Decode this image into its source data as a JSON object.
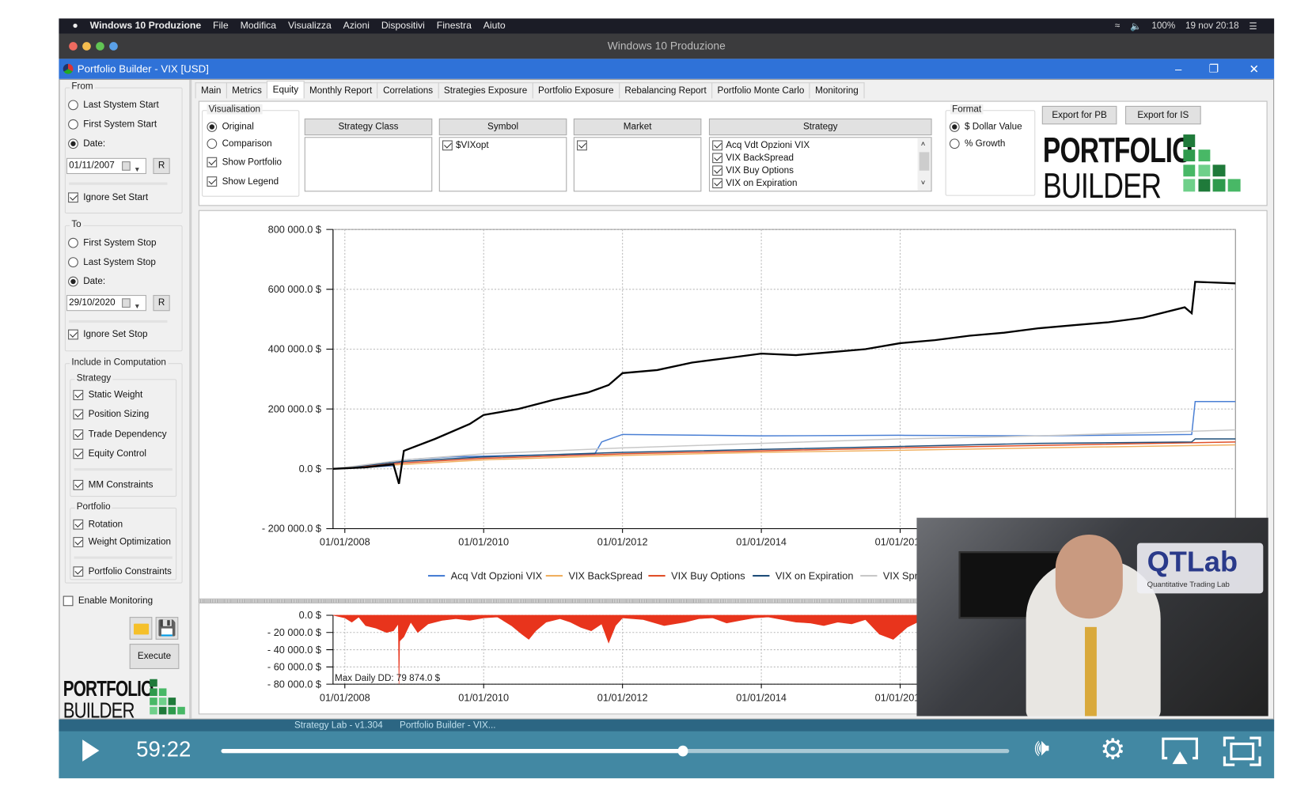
{
  "mac_menubar": {
    "app_name": "Windows 10 Produzione",
    "menus": [
      "File",
      "Modifica",
      "Visualizza",
      "Azioni",
      "Dispositivi",
      "Finestra",
      "Aiuto"
    ],
    "battery": "100%",
    "datetime": "19 nov  20:18"
  },
  "vm_window": {
    "title": "Windows 10 Produzione"
  },
  "app": {
    "title": "Portfolio Builder - VIX [USD]",
    "tabs": [
      {
        "label": "Main",
        "active": false
      },
      {
        "label": "Metrics",
        "active": false
      },
      {
        "label": "Equity",
        "active": true
      },
      {
        "label": "Monthly Report",
        "active": false
      },
      {
        "label": "Correlations",
        "active": false
      },
      {
        "label": "Strategies Exposure",
        "active": false
      },
      {
        "label": "Portfolio Exposure",
        "active": false
      },
      {
        "label": "Rebalancing Report",
        "active": false
      },
      {
        "label": "Portfolio Monte Carlo",
        "active": false
      },
      {
        "label": "Monitoring",
        "active": false
      }
    ]
  },
  "left": {
    "from": {
      "label": "From",
      "options": [
        {
          "label": "Last Stystem Start",
          "checked": false
        },
        {
          "label": "First System Start",
          "checked": false
        },
        {
          "label": "Date:",
          "checked": true
        }
      ],
      "date": "01/11/2007",
      "reset": "R",
      "ignore": {
        "label": "Ignore Set Start",
        "checked": true
      }
    },
    "to": {
      "label": "To",
      "options": [
        {
          "label": "First System Stop",
          "checked": false
        },
        {
          "label": "Last System Stop",
          "checked": false
        },
        {
          "label": "Date:",
          "checked": true
        }
      ],
      "date": "29/10/2020",
      "reset": "R",
      "ignore": {
        "label": "Ignore Set Stop",
        "checked": true
      }
    },
    "include": {
      "label": "Include in Computation",
      "strategy": {
        "label": "Strategy",
        "items": [
          {
            "label": "Static Weight",
            "checked": true
          },
          {
            "label": "Position Sizing",
            "checked": true
          },
          {
            "label": "Trade Dependency",
            "checked": true
          },
          {
            "label": "Equity Control",
            "checked": true
          },
          {
            "label": "MM Constraints",
            "checked": true
          }
        ]
      },
      "portfolio": {
        "label": "Portfolio",
        "items": [
          {
            "label": "Rotation",
            "checked": true
          },
          {
            "label": "Weight Optimization",
            "checked": true
          },
          {
            "label": "Portfolio Constraints",
            "checked": true
          }
        ]
      }
    },
    "enable_monitoring": {
      "label": "Enable Monitoring",
      "checked": false
    },
    "execute": "Execute",
    "logo": {
      "line1": "PORTFOLIO",
      "line2": "BUILDER"
    }
  },
  "visualisation": {
    "label": "Visualisation",
    "modes": [
      {
        "label": "Original",
        "checked": true
      },
      {
        "label": "Comparison",
        "checked": false
      }
    ],
    "show": [
      {
        "label": "Show Portfolio",
        "checked": true
      },
      {
        "label": "Show Legend",
        "checked": true
      }
    ],
    "filters": [
      {
        "header": "Strategy Class",
        "items": []
      },
      {
        "header": "Symbol",
        "items": [
          {
            "label": "$VIXopt",
            "checked": true
          }
        ]
      },
      {
        "header": "Market",
        "items": [
          {
            "label": "",
            "checked": true
          }
        ]
      },
      {
        "header": "Strategy",
        "items": [
          {
            "label": "Acq Vdt Opzioni VIX",
            "checked": true
          },
          {
            "label": "VIX BackSpread",
            "checked": true
          },
          {
            "label": "VIX Buy Options",
            "checked": true
          },
          {
            "label": "VIX on Expiration",
            "checked": true
          }
        ]
      }
    ]
  },
  "format": {
    "label": "Format",
    "options": [
      {
        "label": "$ Dollar Value",
        "checked": true
      },
      {
        "label": "% Growth",
        "checked": false
      }
    ]
  },
  "export": {
    "pb": "Export for PB",
    "is": "Export for IS"
  },
  "brand_logo": {
    "line1": "PORTFOLIO",
    "line2": "BUILDER",
    "color": "#3aa55a"
  },
  "chart_data": [
    {
      "type": "line",
      "y_ticks": [
        "800 000.0 $",
        "600 000.0 $",
        "400 000.0 $",
        "200 000.0 $",
        "0.0 $",
        "- 200 000.0 $"
      ],
      "y_tick_values": [
        800000,
        600000,
        400000,
        200000,
        0,
        -200000
      ],
      "x_ticks": [
        "01/01/2008",
        "01/01/2010",
        "01/01/2012",
        "01/01/2014",
        "01/01/2016"
      ],
      "x_tick_values": [
        2008,
        2010,
        2012,
        2014,
        2016
      ],
      "xlim": [
        "01/11/2007",
        "29/10/2020"
      ],
      "ylim": [
        -200000,
        800000
      ],
      "grid": true,
      "legend_placement": "bottom",
      "series": [
        {
          "name": "Portfolio",
          "color": "#000000",
          "x": [
            2007.83,
            2008.3,
            2008.7,
            2008.78,
            2008.85,
            2009.3,
            2009.8,
            2010.0,
            2010.5,
            2011.0,
            2011.5,
            2011.8,
            2012.0,
            2012.5,
            2013.0,
            2013.5,
            2014.0,
            2014.5,
            2015.0,
            2015.5,
            2016.0,
            2016.5,
            2017.0,
            2017.5,
            2018.0,
            2018.5,
            2019.0,
            2019.5,
            2020.1,
            2020.2,
            2020.25,
            2020.83
          ],
          "y": [
            0,
            5000,
            15000,
            -50000,
            60000,
            100000,
            150000,
            180000,
            200000,
            230000,
            255000,
            280000,
            320000,
            330000,
            355000,
            370000,
            385000,
            380000,
            390000,
            400000,
            420000,
            430000,
            445000,
            455000,
            470000,
            480000,
            490000,
            505000,
            540000,
            520000,
            625000,
            620000
          ]
        },
        {
          "name": "Acq Vdt Opzioni VIX",
          "color": "#4a7fd4",
          "x": [
            2007.83,
            2008.7,
            2008.85,
            2009.5,
            2010.5,
            2011.6,
            2011.7,
            2012.0,
            2014.0,
            2016.0,
            2018.0,
            2020.2,
            2020.25,
            2020.83
          ],
          "y": [
            0,
            10000,
            30000,
            40000,
            45000,
            50000,
            90000,
            115000,
            110000,
            112000,
            110000,
            115000,
            225000,
            225000
          ]
        },
        {
          "name": "VIX BackSpread",
          "color": "#f0b060",
          "x": [
            2007.83,
            2008.85,
            2010.0,
            2012.0,
            2014.0,
            2016.0,
            2018.0,
            2020.83
          ],
          "y": [
            0,
            15000,
            30000,
            45000,
            55000,
            62000,
            70000,
            80000
          ]
        },
        {
          "name": "VIX Buy Options",
          "color": "#e0502a",
          "x": [
            2007.83,
            2008.85,
            2010.0,
            2012.0,
            2014.0,
            2016.0,
            2018.0,
            2020.83
          ],
          "y": [
            0,
            20000,
            35000,
            50000,
            60000,
            70000,
            78000,
            90000
          ]
        },
        {
          "name": "VIX on Expiration",
          "color": "#1f4e79",
          "x": [
            2007.83,
            2008.85,
            2010.0,
            2012.0,
            2014.0,
            2016.0,
            2018.0,
            2020.2,
            2020.25,
            2020.83
          ],
          "y": [
            0,
            25000,
            40000,
            55000,
            65000,
            75000,
            85000,
            90000,
            100000,
            100000
          ]
        },
        {
          "name": "VIX Spread",
          "color": "#c8c8c8",
          "x": [
            2007.83,
            2008.85,
            2010.0,
            2012.0,
            2014.0,
            2016.0,
            2018.0,
            2020.83
          ],
          "y": [
            0,
            30000,
            50000,
            70000,
            85000,
            100000,
            110000,
            130000
          ]
        }
      ]
    },
    {
      "type": "area",
      "y_ticks": [
        "0.0 $",
        "- 20 000.0 $",
        "- 40 000.0 $",
        "- 60 000.0 $",
        "- 80 000.0 $"
      ],
      "y_tick_values": [
        0,
        -20000,
        -40000,
        -60000,
        -80000
      ],
      "x_ticks": [
        "01/01/2008",
        "01/01/2010",
        "01/01/2012",
        "01/01/2014",
        "01/01/2016"
      ],
      "x_tick_values": [
        2008,
        2010,
        2012,
        2014,
        2016
      ],
      "ylim": [
        -80000,
        0
      ],
      "annotation": "Max Daily DD:   79 874.0 $",
      "color": "#e8341c",
      "x": [
        2007.83,
        2008.0,
        2008.1,
        2008.2,
        2008.3,
        2008.45,
        2008.6,
        2008.7,
        2008.77,
        2008.78,
        2008.79,
        2008.85,
        2008.95,
        2009.05,
        2009.2,
        2009.4,
        2009.6,
        2009.8,
        2010.0,
        2010.2,
        2010.4,
        2010.55,
        2010.65,
        2010.75,
        2010.9,
        2011.1,
        2011.25,
        2011.4,
        2011.55,
        2011.7,
        2011.8,
        2011.9,
        2012.0,
        2012.3,
        2012.6,
        2012.9,
        2013.1,
        2013.3,
        2013.5,
        2013.7,
        2013.9,
        2014.1,
        2014.3,
        2014.5,
        2014.7,
        2014.9,
        2015.1,
        2015.3,
        2015.5,
        2015.7,
        2015.9,
        2016.1,
        2016.3,
        2016.5,
        2016.7,
        2016.9,
        2017.2,
        2017.5,
        2017.8,
        2018.0,
        2018.1,
        2018.3,
        2018.6,
        2018.9,
        2019.2,
        2019.5,
        2019.8,
        2020.1,
        2020.2,
        2020.3,
        2020.5,
        2020.83
      ],
      "y": [
        0,
        -3000,
        -8000,
        -2000,
        -12000,
        -15000,
        -20000,
        -18000,
        -10000,
        -79874,
        -30000,
        -25000,
        -8000,
        -20000,
        -10000,
        -6000,
        -4000,
        -6000,
        -3000,
        -2000,
        -12000,
        -22000,
        -28000,
        -18000,
        -8000,
        -4000,
        -8000,
        -14000,
        -18000,
        -10000,
        -32000,
        -12000,
        -3000,
        -5000,
        -12000,
        -8000,
        -4000,
        -3000,
        -9000,
        -6000,
        -3000,
        -2000,
        -5000,
        -8000,
        -9000,
        -12000,
        -8000,
        -10000,
        -5000,
        -22000,
        -28000,
        -14000,
        -6000,
        -4000,
        -3000,
        -8000,
        -5000,
        -3000,
        -6000,
        -4000,
        -15000,
        -8000,
        -10000,
        -14000,
        -8000,
        -6000,
        -4000,
        -5000,
        -35000,
        -10000,
        -4000,
        -2000
      ]
    }
  ],
  "webcam": {
    "logo": "QTLab",
    "tagline": "Quantitative Trading Lab"
  },
  "taskbar": {
    "items": [
      "Strategy Lab - v1.304",
      "Portfolio Builder - VIX..."
    ]
  },
  "player": {
    "time": "59:22",
    "progress": 0.586,
    "icons": [
      "play-icon",
      "volume-icon",
      "settings-icon",
      "airplay-icon",
      "fullscreen-icon"
    ]
  }
}
